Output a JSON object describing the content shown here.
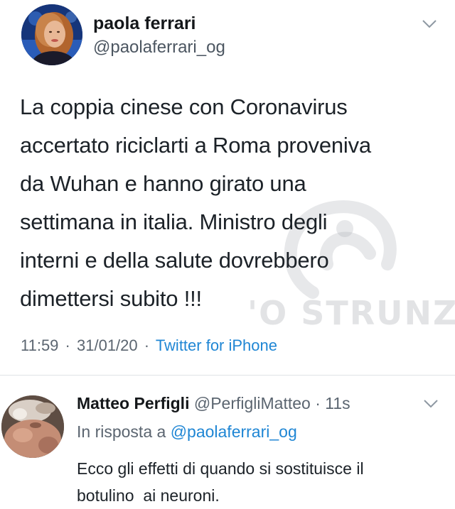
{
  "tweet": {
    "author_name": "paola ferrari",
    "author_handle": "@paolaferrari_og",
    "text_lines": [
      "La coppia cinese con Coronavirus",
      "accertato riciclarti a Roma proveniva",
      "da Wuhan e hanno girato una",
      "settimana in italia. Ministro degli",
      "interni e della salute dovrebbero",
      "dimettersi subito !!!"
    ],
    "time": "11:59",
    "separator": "·",
    "date": "31/01/20",
    "source": "Twitter for iPhone",
    "menu_icon": "chevron-down-icon"
  },
  "watermark": {
    "text": "'O STRUNZ"
  },
  "reply": {
    "author_name": "Matteo Perfigli",
    "author_handle": "@PerfigliMatteo",
    "separator": "·",
    "age": "11s",
    "reply_prefix": "In risposta a",
    "reply_mention": "@paolaferrari_og",
    "text_lines": [
      "Ecco gli effetti di quando si sostituisce il",
      "botulino  ai neuroni."
    ],
    "menu_icon": "chevron-down-icon"
  },
  "colors": {
    "link": "#1f86d4",
    "secondary_text": "#5b6570",
    "primary_text": "#14171a",
    "divider": "#dfe3e6"
  }
}
